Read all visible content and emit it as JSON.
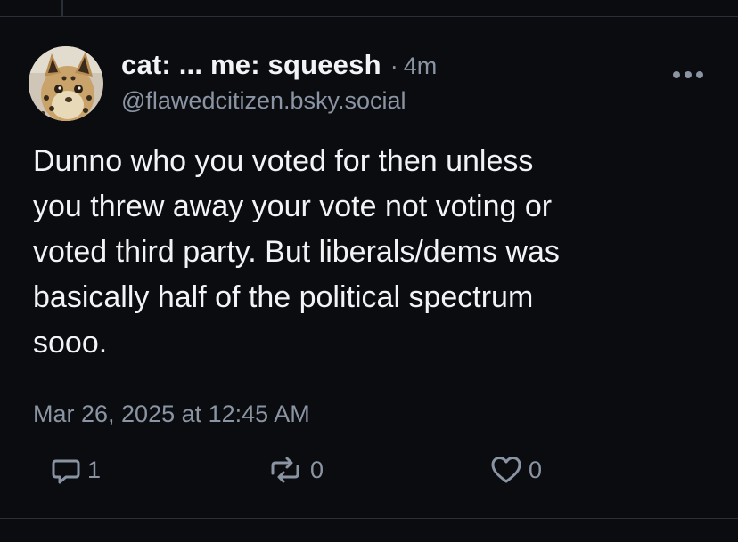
{
  "post": {
    "author": {
      "display_name": "cat: ... me: squeesh",
      "handle": "@flawedcitizen.bsky.social",
      "avatar_icon": "serval-cat-avatar"
    },
    "time_ago_separator": "·",
    "time_ago": "4m",
    "text": "Dunno who you voted for then unless\nyou threw away your vote not voting or\nvoted third party. But liberals/dems was\nbasically half of the political spectrum\nsooo.",
    "timestamp": "Mar 26, 2025 at 12:45 AM",
    "actions": {
      "reply": {
        "icon": "reply-icon",
        "count": "1"
      },
      "repost": {
        "icon": "repost-icon",
        "count": "0"
      },
      "like": {
        "icon": "heart-icon",
        "count": "0"
      }
    },
    "more_icon": "more-horizontal-icon"
  },
  "colors": {
    "background": "#0b0c10",
    "text": "#f1f3f5",
    "muted": "#8a94a3",
    "divider": "#2a2f38"
  }
}
